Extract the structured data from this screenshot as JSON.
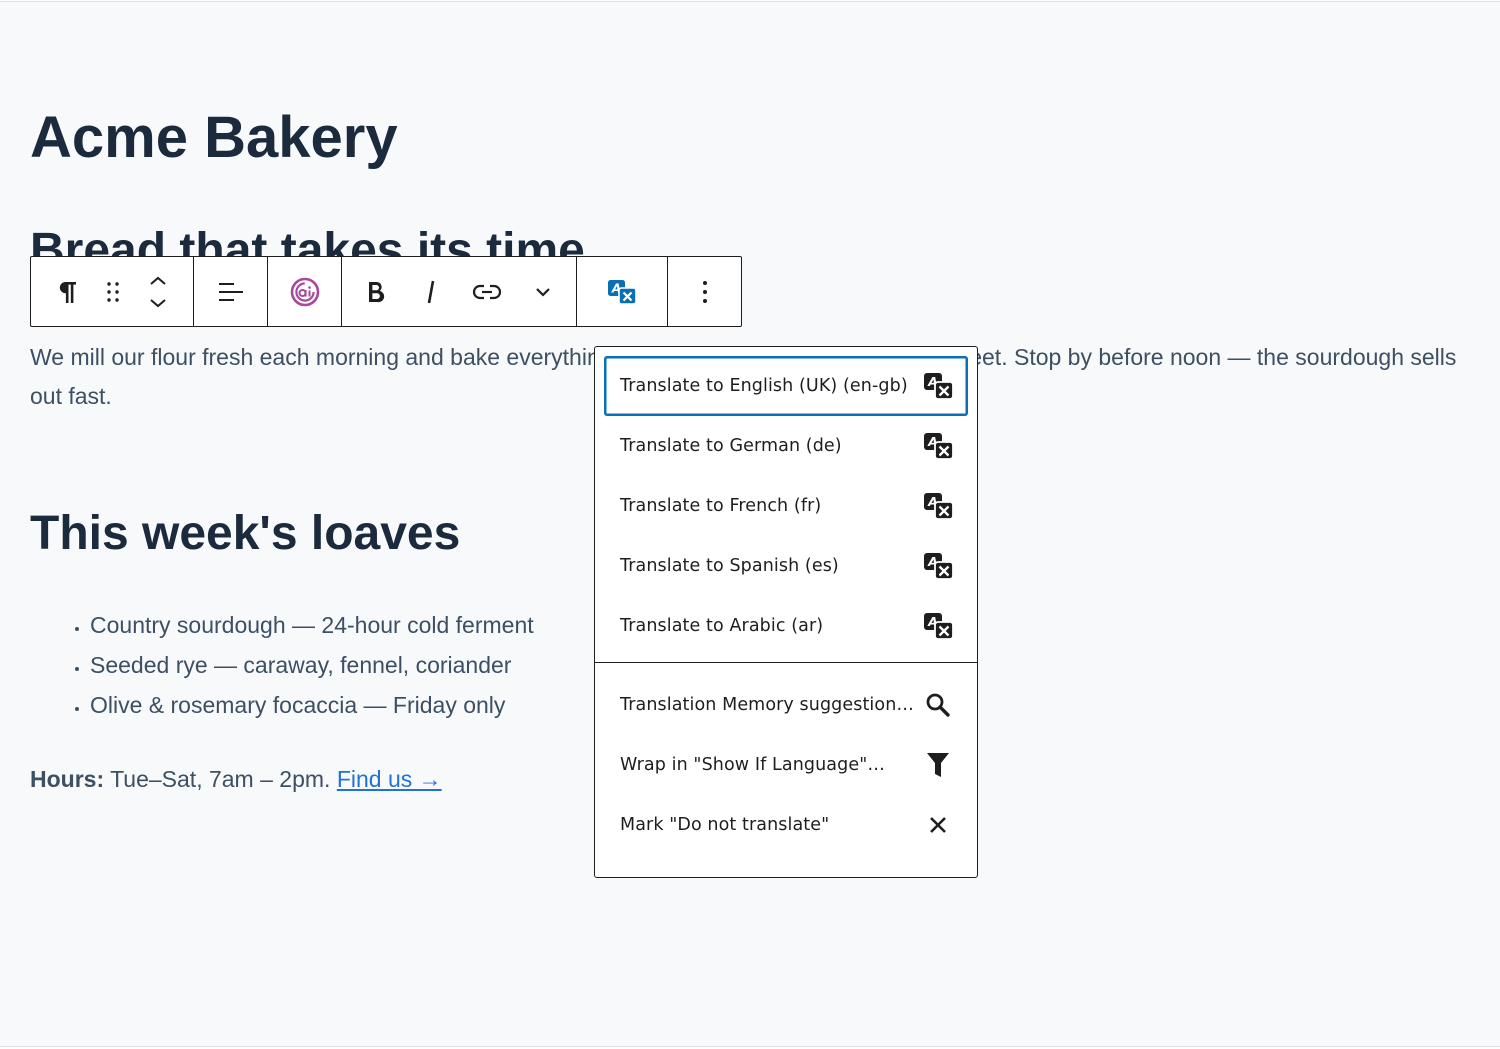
{
  "page": {
    "site_title": "Acme Bakery",
    "hero_heading": "Bread that takes its time",
    "intro_text": "We mill our flour fresh each morning and bake everything in the wood-fired oven on Main Street. Stop by before noon — the sourdough sells out fast.",
    "section_heading": "This week's loaves",
    "loaves": [
      "Country sourdough — 24-hour cold ferment",
      "Seeded rye — caraway, fennel, coriander",
      "Olive & rosemary focaccia — Friday only"
    ],
    "hours_label": "Hours:",
    "hours_text": " Tue–Sat, 7am – 2pm. ",
    "hours_link": "Find us →"
  },
  "toolbar": {
    "buttons": [
      {
        "name": "paragraph-icon",
        "title": "Paragraph"
      },
      {
        "name": "drag-handle-icon",
        "title": "Drag"
      },
      {
        "name": "move-up-down-icon",
        "title": "Move up/down"
      },
      {
        "name": "align-left-icon",
        "title": "Align text"
      },
      {
        "name": "ai-icon",
        "title": "AI assistant"
      },
      {
        "name": "bold-icon",
        "title": "Bold"
      },
      {
        "name": "italic-icon",
        "title": "Italic"
      },
      {
        "name": "link-icon",
        "title": "Link"
      },
      {
        "name": "chevron-down-icon",
        "title": "More rich text controls"
      },
      {
        "name": "translate-icon",
        "title": "Translate"
      },
      {
        "name": "more-vertical-icon",
        "title": "Options"
      }
    ],
    "accent_color": "#0a70b5",
    "ai_color": "#a8489c"
  },
  "menu": {
    "translate_items": [
      {
        "label": "Translate to English (UK) (en-gb)",
        "icon": "translate-icon",
        "focused": true
      },
      {
        "label": "Translate to German (de)",
        "icon": "translate-icon"
      },
      {
        "label": "Translate to French (fr)",
        "icon": "translate-icon"
      },
      {
        "label": "Translate to Spanish (es)",
        "icon": "translate-icon"
      },
      {
        "label": "Translate to Arabic (ar)",
        "icon": "translate-icon"
      }
    ],
    "other_items": [
      {
        "label": "Translation Memory suggestions…",
        "icon": "search-icon"
      },
      {
        "label": "Wrap in \"Show If Language\"…",
        "icon": "filter-icon"
      },
      {
        "label": "Mark \"Do not translate\"",
        "icon": "close-icon"
      }
    ]
  }
}
